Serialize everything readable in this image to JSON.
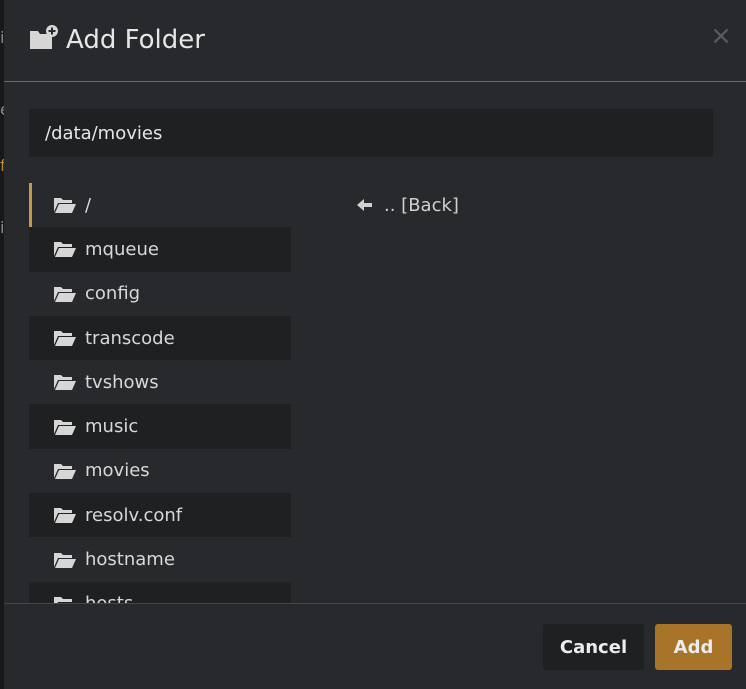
{
  "dialog": {
    "title": "Add Folder",
    "close_label": "×"
  },
  "path_input": {
    "value": "/data/movies"
  },
  "folders": [
    {
      "name": "/"
    },
    {
      "name": "mqueue"
    },
    {
      "name": "config"
    },
    {
      "name": "transcode"
    },
    {
      "name": "tvshows"
    },
    {
      "name": "music"
    },
    {
      "name": "movies"
    },
    {
      "name": "resolv.conf"
    },
    {
      "name": "hostname"
    },
    {
      "name": "hosts"
    }
  ],
  "back_link": {
    "label": ".. [Back]"
  },
  "footer": {
    "cancel_label": "Cancel",
    "add_label": "Add"
  },
  "background_glyphs": [
    "i",
    "e",
    "f",
    "i"
  ],
  "colors": {
    "accent": "#a8742a",
    "selected_border": "#c49a48",
    "modal_bg": "#27292c",
    "row_alt_bg": "#1e2022"
  }
}
